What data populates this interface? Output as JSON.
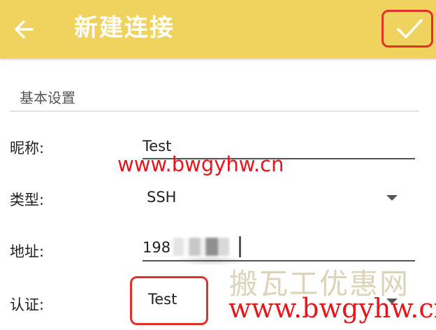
{
  "appbar": {
    "title": "新建连接",
    "back_icon": "arrow-left-icon",
    "confirm_icon": "check-icon",
    "background": "#f0d35e"
  },
  "section": {
    "title": "基本设置"
  },
  "form": {
    "nickname": {
      "label": "昵称:",
      "value": "Test"
    },
    "type": {
      "label": "类型:",
      "value": "SSH"
    },
    "address": {
      "label": "地址:",
      "value": "198"
    },
    "auth": {
      "label": "认证:",
      "value": "Test"
    }
  },
  "watermark": {
    "url_top": "www.bwgyhw.cn",
    "brand": "搬瓦工优惠网",
    "url_bottom": "www.bwgyhw.cn"
  },
  "colors": {
    "highlight": "#e5302a",
    "watermark_red": "#e8151b"
  }
}
